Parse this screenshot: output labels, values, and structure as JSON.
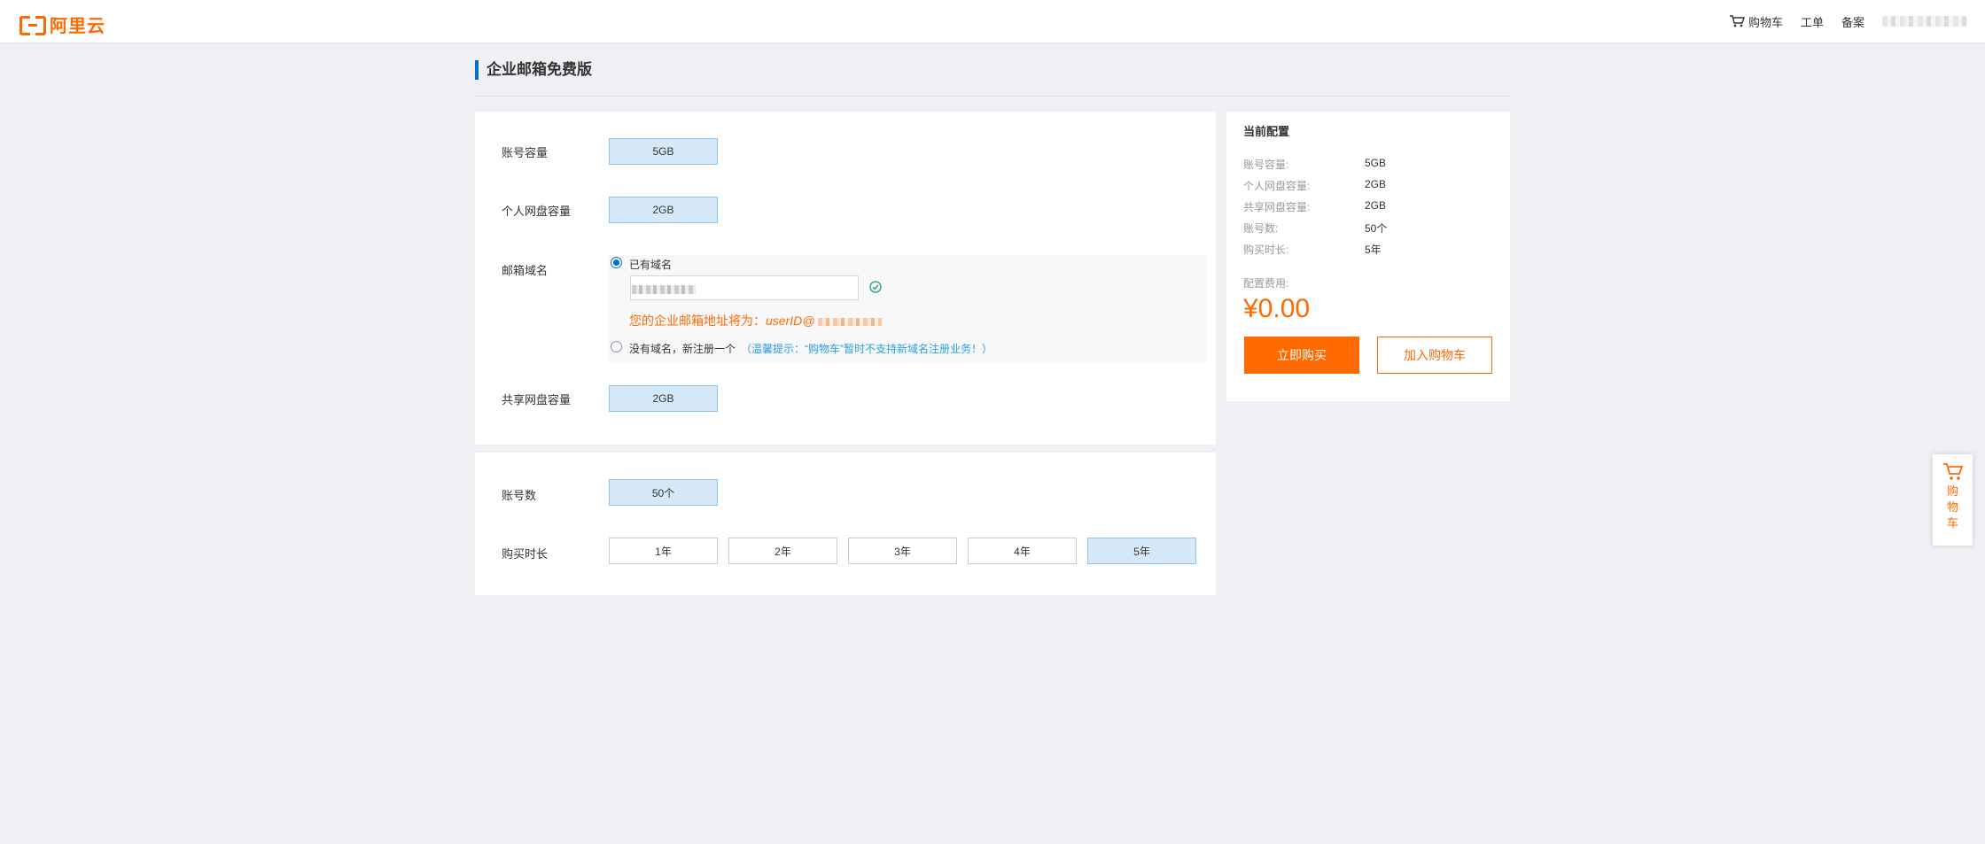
{
  "header": {
    "logo_text": "阿里云",
    "nav": {
      "cart": "购物车",
      "ticket": "工单",
      "record": "备案"
    }
  },
  "page": {
    "title": "企业邮箱免费版"
  },
  "config": {
    "account_capacity": {
      "label": "账号容量",
      "value": "5GB"
    },
    "personal_disk": {
      "label": "个人网盘容量",
      "value": "2GB"
    },
    "domain": {
      "label": "邮箱域名",
      "option_existing": "已有域名",
      "address_prefix": "您的企业邮箱地址将为：",
      "address_user": "userID@",
      "option_new": "没有域名，新注册一个",
      "option_new_hint": "（温馨提示：“购物车”暂时不支持新域名注册业务！）"
    },
    "shared_disk": {
      "label": "共享网盘容量",
      "value": "2GB"
    },
    "account_count": {
      "label": "账号数",
      "value": "50个"
    },
    "duration": {
      "label": "购买时长",
      "options": [
        "1年",
        "2年",
        "3年",
        "4年",
        "5年"
      ],
      "selected": "5年"
    }
  },
  "summary": {
    "title": "当前配置",
    "items": [
      {
        "key": "账号容量:",
        "value": "5GB"
      },
      {
        "key": "个人网盘容量:",
        "value": "2GB"
      },
      {
        "key": "共享网盘容量:",
        "value": "2GB"
      },
      {
        "key": "账号数:",
        "value": "50个"
      },
      {
        "key": "购买时长:",
        "value": "5年"
      }
    ],
    "fee_label": "配置费用:",
    "price": "¥0.00",
    "buy_label": "立即购买",
    "add_cart_label": "加入购物车"
  },
  "float_cart": {
    "label": "购物车"
  },
  "colors": {
    "accent": "#ff6a00",
    "selected_bg": "#d6e9f8",
    "link": "#2a9fd6",
    "brand_blue": "#0070cc"
  }
}
